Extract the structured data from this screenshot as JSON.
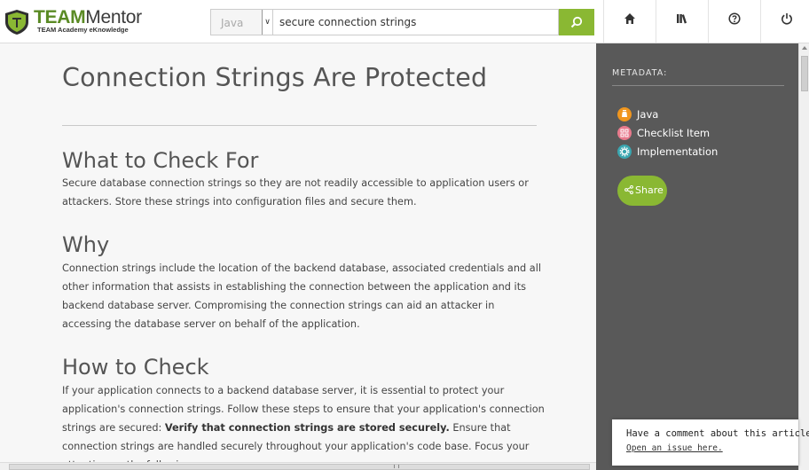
{
  "header": {
    "brand_main": "TEAM",
    "brand_sub": "Mentor",
    "tagline": "TEAM Academy eKnowledge"
  },
  "search": {
    "language_selected": "Java",
    "query": "secure connection strings"
  },
  "nav": {
    "icons": [
      "home-icon",
      "library-icon",
      "help-icon",
      "power-icon"
    ]
  },
  "article": {
    "title": "Connection Strings Are Protected",
    "sections": [
      {
        "heading": "What to Check For",
        "paragraph": "Secure database connection strings so they are not readily accessible to application users or attackers. Store these strings into configuration files and secure them."
      },
      {
        "heading": "Why",
        "paragraph": "Connection strings include the location of the backend database, associated credentials and all other information that assists in establishing the connection between the application and its backend database server. Compromising the connection strings can aid an attacker in accessing the database server on behalf of the application."
      },
      {
        "heading": "How to Check",
        "paragraph_intro": "If your application connects to a backend database server, it is essential to protect your application's connection strings. Follow these steps to ensure that your application's connection strings are secured:",
        "paragraph_bold": "Verify that connection strings are stored securely.",
        "paragraph_rest": " Ensure that connection strings are handled securely throughout your application's code base. Focus your attention on the following:"
      }
    ]
  },
  "sidebar": {
    "metadata_label": "METADATA:",
    "items": [
      {
        "label": "Java",
        "icon": "java-icon",
        "color": "#f0961e"
      },
      {
        "label": "Checklist Item",
        "icon": "checklist-icon",
        "color": "#e87a8c"
      },
      {
        "label": "Implementation",
        "icon": "gear-icon",
        "color": "#3aa6b0"
      }
    ],
    "share_label": "Share"
  },
  "comment": {
    "question": "Have a comment about this article?",
    "link": "Open an issue here."
  },
  "colors": {
    "accent": "#8ab833",
    "sidebar_bg": "#595959"
  }
}
